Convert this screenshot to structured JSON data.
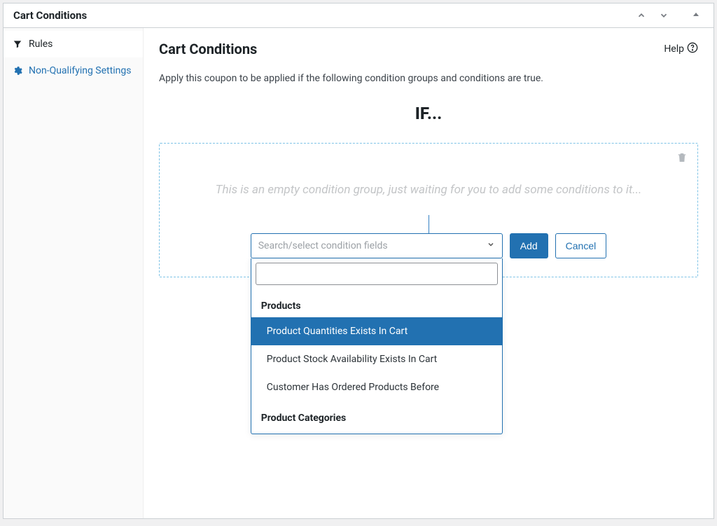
{
  "header": {
    "title": "Cart Conditions"
  },
  "sidebar": {
    "items": [
      {
        "label": "Rules",
        "icon": "filter-icon",
        "active": true
      },
      {
        "label": "Non-Qualifying Settings",
        "icon": "gear-icon",
        "active": false
      }
    ]
  },
  "main": {
    "title": "Cart Conditions",
    "help_label": "Help",
    "description": "Apply this coupon to be applied if the following condition groups and conditions are true.",
    "if_label": "IF...",
    "empty_group_message": "This is an empty condition group, just waiting for you to add some conditions to it...",
    "select_placeholder": "Search/select condition fields",
    "add_button": "Add",
    "cancel_button": "Cancel"
  },
  "dropdown": {
    "search_value": "",
    "groups": [
      {
        "label": "Products",
        "options": [
          {
            "label": "Product Quantities Exists In Cart",
            "highlight": true
          },
          {
            "label": "Product Stock Availability Exists In Cart",
            "highlight": false
          },
          {
            "label": "Customer Has Ordered Products Before",
            "highlight": false
          }
        ]
      },
      {
        "label": "Product Categories",
        "options": []
      }
    ]
  }
}
